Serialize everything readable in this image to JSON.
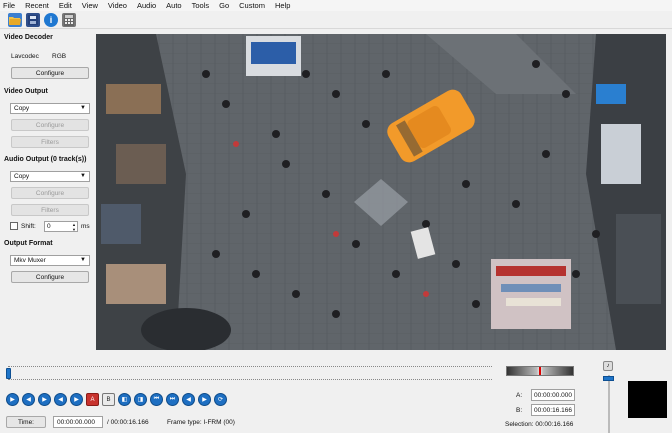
{
  "menubar": [
    "File",
    "Recent",
    "Edit",
    "View",
    "Video",
    "Audio",
    "Auto",
    "Tools",
    "Go",
    "Custom",
    "Help"
  ],
  "toolbar": {
    "icons": [
      "open-folder-icon",
      "save-icon",
      "info-icon",
      "calculator-icon"
    ],
    "info_glyph": "i"
  },
  "video_decoder": {
    "title": "Video Decoder",
    "decoder": "Lavcodec",
    "colorspace": "RGB",
    "configure_label": "Configure"
  },
  "video_output": {
    "title": "Video Output",
    "codec": "Copy",
    "configure_label": "Configure",
    "filters_label": "Filters"
  },
  "audio_output": {
    "title": "Audio Output (0 track(s))",
    "codec": "Copy",
    "configure_label": "Configure",
    "filters_label": "Filters",
    "shift_label": "Shift:",
    "shift_value": "0",
    "shift_unit": "ms"
  },
  "output_format": {
    "title": "Output Format",
    "muxer": "Mkv Muxer",
    "configure_label": "Configure"
  },
  "playback": {
    "position_fraction": 0.0,
    "controls": [
      "play-icon",
      "rewind-icon",
      "forward-icon",
      "prev-frame-icon",
      "next-frame-icon",
      "marker-a-icon",
      "marker-b-icon",
      "prev-black-icon",
      "next-black-icon",
      "first-frame-icon",
      "last-frame-icon",
      "prev-key-icon",
      "next-key-icon",
      "goto-icon"
    ],
    "marker_a_glyph": "A",
    "marker_b_glyph": "B",
    "time_button_label": "Time:",
    "current_time": "00:00:00.000",
    "total_time": "/ 00:00:16.166",
    "frame_type": "Frame type:  I-FRM (00)"
  },
  "selection": {
    "a_label": "A:",
    "a_value": "00:00:00.000",
    "b_label": "B:",
    "b_value": "00:00:16.166",
    "selection_text": "Selection: 00:00:16.166"
  },
  "colors": {
    "accent": "#1e74c8",
    "taxi": "#f29a2a"
  }
}
